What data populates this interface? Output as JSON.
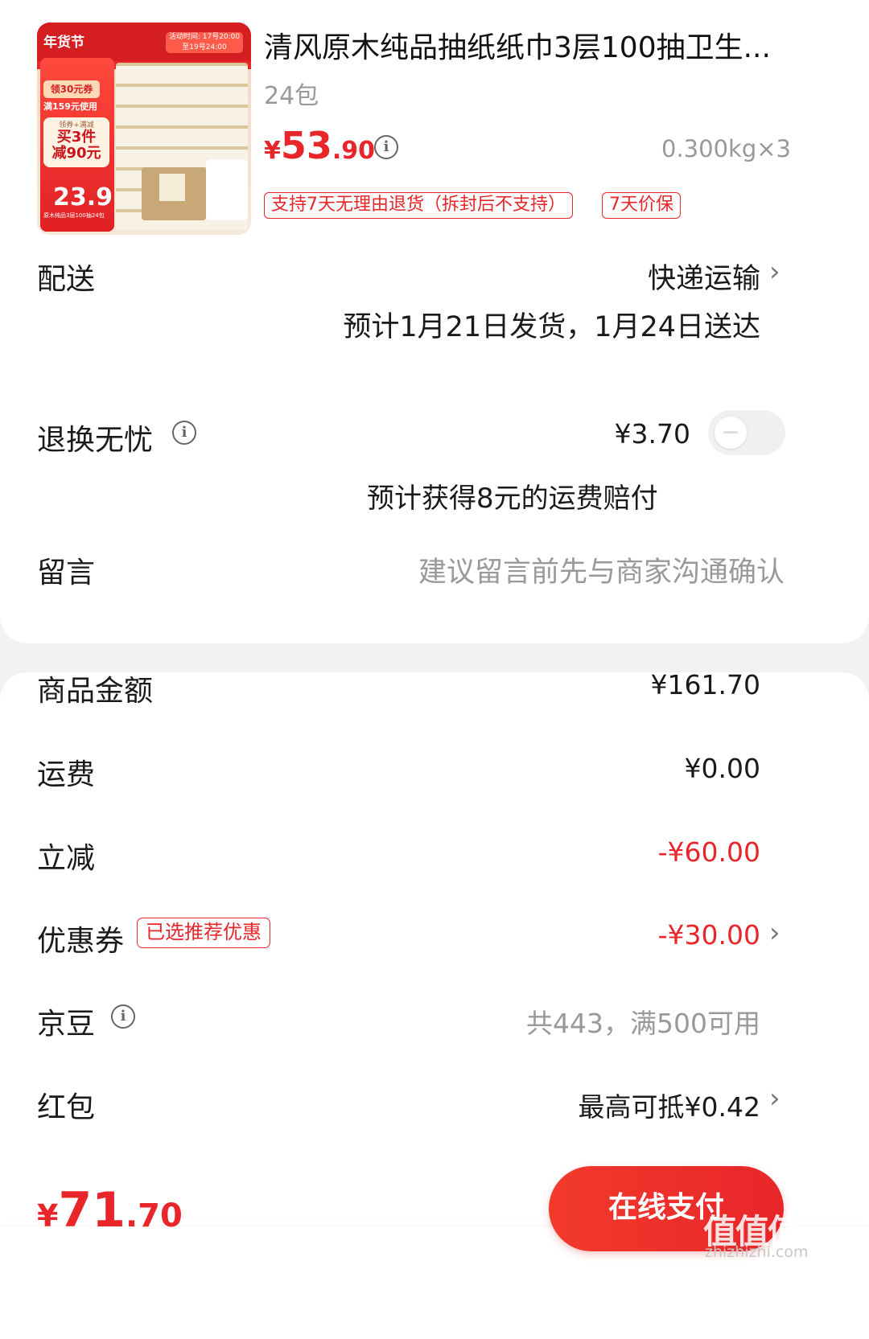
{
  "product": {
    "title": "清风原木纯品抽纸纸巾3层100抽卫生...",
    "spec": "24包",
    "price_yen": "¥",
    "price_int": "53",
    "price_dec": ".90",
    "weight": "0.300kg×3",
    "badges": [
      "支持7天无理由退货（拆封后不支持）",
      "7天价保"
    ],
    "thumb": {
      "tag_left": "年货节",
      "tag_right": "活动时间: 17号20:00至19号24:00",
      "coupon": "领30元券",
      "coupon_sub": "满159元使用",
      "promo_sub": "领券+满减",
      "promo_line1": "买3件",
      "promo_line2": "减90元",
      "promo_price": "23.9",
      "tiny": "原木纯品3层100抽24包"
    }
  },
  "delivery": {
    "label": "配送",
    "method": "快递运输",
    "estimate": "预计1月21日发货，1月24日送达"
  },
  "return_ins": {
    "label": "退换无忧",
    "price": "¥3.70",
    "note": "预计获得8元的运费赔付",
    "enabled": false
  },
  "message": {
    "label": "留言",
    "placeholder": "建议留言前先与商家沟通确认"
  },
  "summary": {
    "goods_label": "商品金额",
    "goods_value": "¥161.70",
    "shipping_label": "运费",
    "shipping_value": "¥0.00",
    "discount_label": "立减",
    "discount_value": "-¥60.00",
    "coupon_label": "优惠券",
    "coupon_tag": "已选推荐优惠",
    "coupon_value": "-¥30.00",
    "beans_label": "京豆",
    "beans_value": "共443，满500可用",
    "redpacket_label": "红包",
    "redpacket_value": "最高可抵¥0.42"
  },
  "footer": {
    "total_yen": "¥",
    "total_int": "71",
    "total_dec": ".70",
    "pay_label": "在线支付"
  },
  "watermark": {
    "logo": "值值值",
    "url": "zhizhizhi.com"
  },
  "colors": {
    "accent": "#e8262a",
    "muted": "#999999",
    "background": "#f2f2f2"
  },
  "icons": [
    "info-icon",
    "chevron-right-icon",
    "toggle-switch"
  ]
}
